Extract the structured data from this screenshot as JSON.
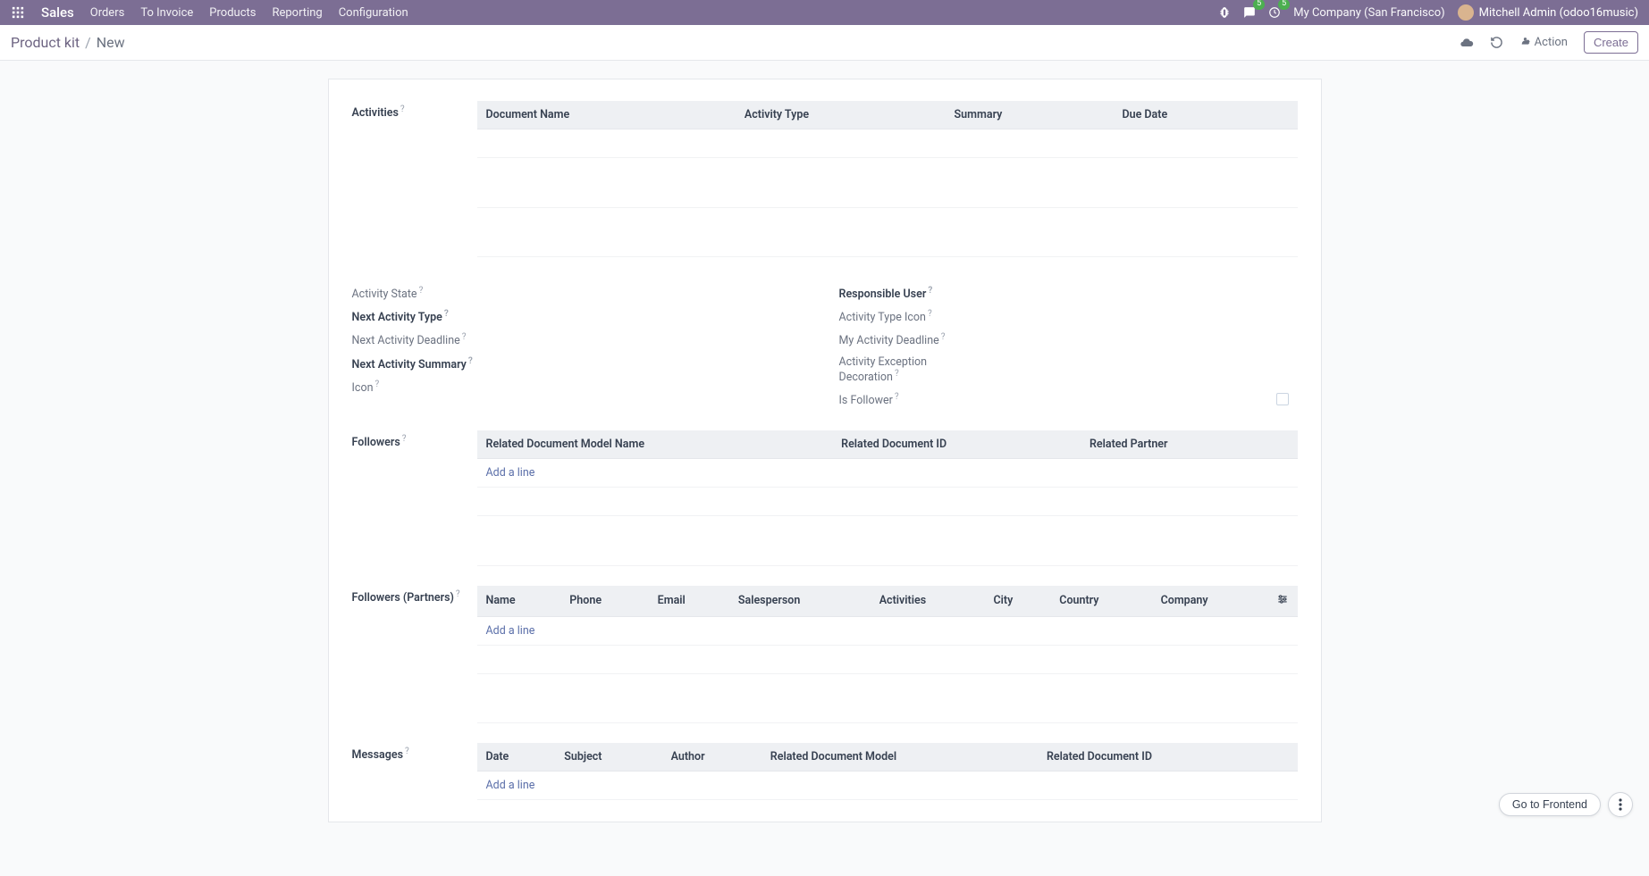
{
  "navbar": {
    "brand": "Sales",
    "items": [
      "Orders",
      "To Invoice",
      "Products",
      "Reporting",
      "Configuration"
    ],
    "messages_badge": "5",
    "activities_badge": "5",
    "company": "My Company (San Francisco)",
    "user": "Mitchell Admin (odoo16music)"
  },
  "breadcrumb": {
    "parent": "Product kit",
    "sep": "/",
    "current": "New"
  },
  "actions": {
    "action_label": "Action",
    "create_label": "Create"
  },
  "form": {
    "activities": {
      "label": "Activities",
      "columns": [
        "Document Name",
        "Activity Type",
        "Summary",
        "Due Date"
      ]
    },
    "fields_left": [
      {
        "label": "Activity State",
        "muted": true,
        "bold": false
      },
      {
        "label": "Next Activity Type",
        "muted": false,
        "bold": true
      },
      {
        "label": "Next Activity Deadline",
        "muted": true,
        "bold": false
      },
      {
        "label": "Next Activity Summary",
        "muted": false,
        "bold": true
      },
      {
        "label": "Icon",
        "muted": true,
        "bold": false
      }
    ],
    "fields_right": [
      {
        "label": "Responsible User",
        "muted": false,
        "bold": true,
        "checkbox": false
      },
      {
        "label": "Activity Type Icon",
        "muted": true,
        "bold": false,
        "checkbox": false
      },
      {
        "label": "My Activity Deadline",
        "muted": true,
        "bold": false,
        "checkbox": false
      },
      {
        "label": "Activity Exception Decoration",
        "muted": true,
        "bold": false,
        "checkbox": false
      },
      {
        "label": "Is Follower",
        "muted": true,
        "bold": false,
        "checkbox": true
      }
    ],
    "followers": {
      "label": "Followers",
      "columns": [
        "Related Document Model Name",
        "Related Document ID",
        "Related Partner"
      ],
      "add_line": "Add a line"
    },
    "followers_partners": {
      "label": "Followers (Partners)",
      "columns": [
        "Name",
        "Phone",
        "Email",
        "Salesperson",
        "Activities",
        "City",
        "Country",
        "Company"
      ],
      "add_line": "Add a line"
    },
    "messages": {
      "label": "Messages",
      "columns": [
        "Date",
        "Subject",
        "Author",
        "Related Document Model",
        "Related Document ID"
      ],
      "add_line": "Add a line"
    }
  },
  "floating": {
    "go_frontend": "Go to Frontend"
  }
}
